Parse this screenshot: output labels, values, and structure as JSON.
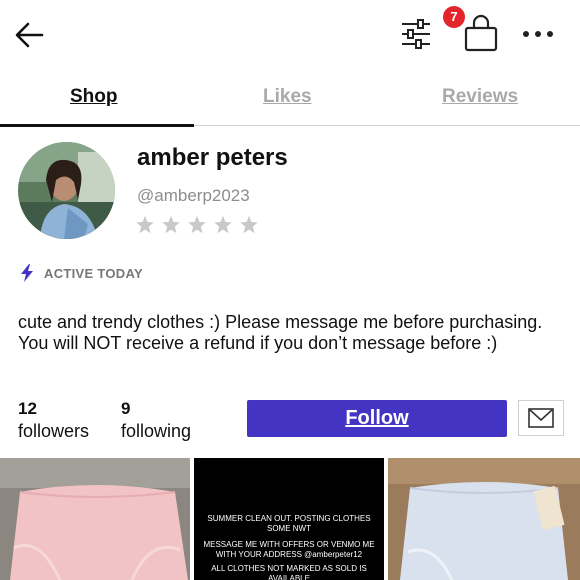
{
  "header": {
    "back_icon": "arrow-left-icon",
    "filter_icon": "sliders-icon",
    "bag_icon": "shopping-bag-icon",
    "bag_badge_count": "7",
    "bag_badge_color": "#e3262b",
    "more_icon": "more-dots-icon"
  },
  "tabs": [
    {
      "label": "Shop",
      "active": true
    },
    {
      "label": "Likes",
      "active": false
    },
    {
      "label": "Reviews",
      "active": false
    }
  ],
  "profile": {
    "name": "amber peters",
    "handle": "@amberp2023",
    "rating_stars": 5,
    "rating_filled": 0,
    "active_status": "ACTIVE TODAY",
    "active_icon": "lightning-bolt-icon",
    "accent_color": "#4434c4",
    "bio": "cute and trendy clothes :) Please message me before purchasing. You will NOT receive a refund if you don’t message before :)"
  },
  "stats": {
    "followers_count": "12",
    "followers_label": "followers",
    "following_count": "9",
    "following_label": "following"
  },
  "actions": {
    "follow_label": "Follow",
    "message_icon": "envelope-icon"
  },
  "listings": [
    {
      "kind": "photo",
      "subject": "pink athletic shorts"
    },
    {
      "kind": "text-card",
      "lines": [
        "SUMMER CLEAN OUT. POSTING CLOTHES SOME NWT",
        "MESSAGE ME WITH OFFERS OR VENMO ME WITH YOUR ADDRESS @amberpeter12",
        "ALL CLOTHES NOT MARKED AS SOLD IS AVAILABLE"
      ]
    },
    {
      "kind": "photo",
      "subject": "light blue athletic shorts"
    }
  ]
}
